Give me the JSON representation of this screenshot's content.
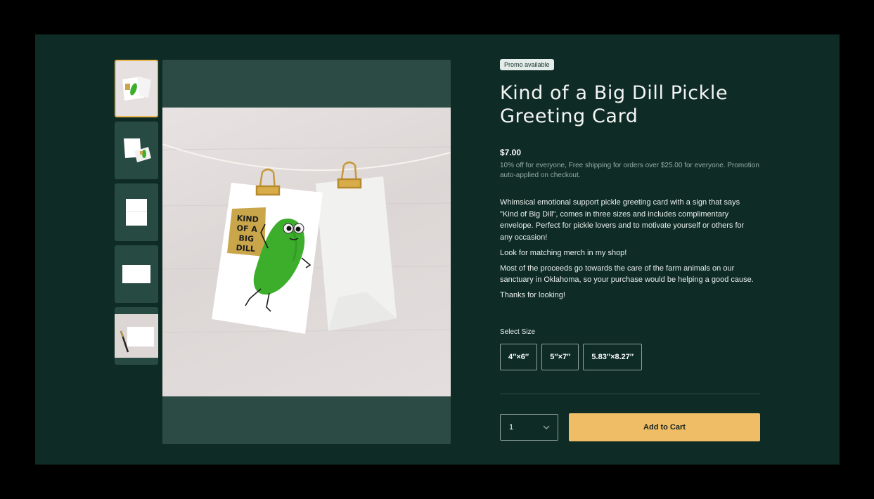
{
  "product": {
    "promo_badge": "Promo available",
    "title": "Kind of a Big Dill Pickle Greeting Card",
    "price": "$7.00",
    "promo_text": "10% off for everyone, Free shipping for orders over $25.00 for everyone. Promotion auto-applied on checkout.",
    "description": [
      "Whimsical emotional support pickle greeting card with a sign that says \"Kind of Big Dill\", comes in three sizes and includes complimentary envelope. Perfect for pickle lovers and to motivate yourself or others for any occasion!",
      "Look for matching merch in my shop!",
      "Most of the proceeds go towards the care of the farm animals on our sanctuary in Oklahoma, so your purchase would be helping a good cause.",
      "Thanks for looking!"
    ],
    "card_sign_lines": [
      "KIND",
      "OF A",
      "BIG",
      "DILL"
    ]
  },
  "size_selector": {
    "label": "Select Size",
    "options": [
      "4″×6″",
      "5″×7″",
      "5.83″×8.27″"
    ]
  },
  "quantity": {
    "value": "1"
  },
  "cart": {
    "add_label": "Add to Cart"
  },
  "colors": {
    "background": "#0f2b26",
    "accent_button": "#efbd66",
    "active_thumb_border": "#e9b94f"
  }
}
